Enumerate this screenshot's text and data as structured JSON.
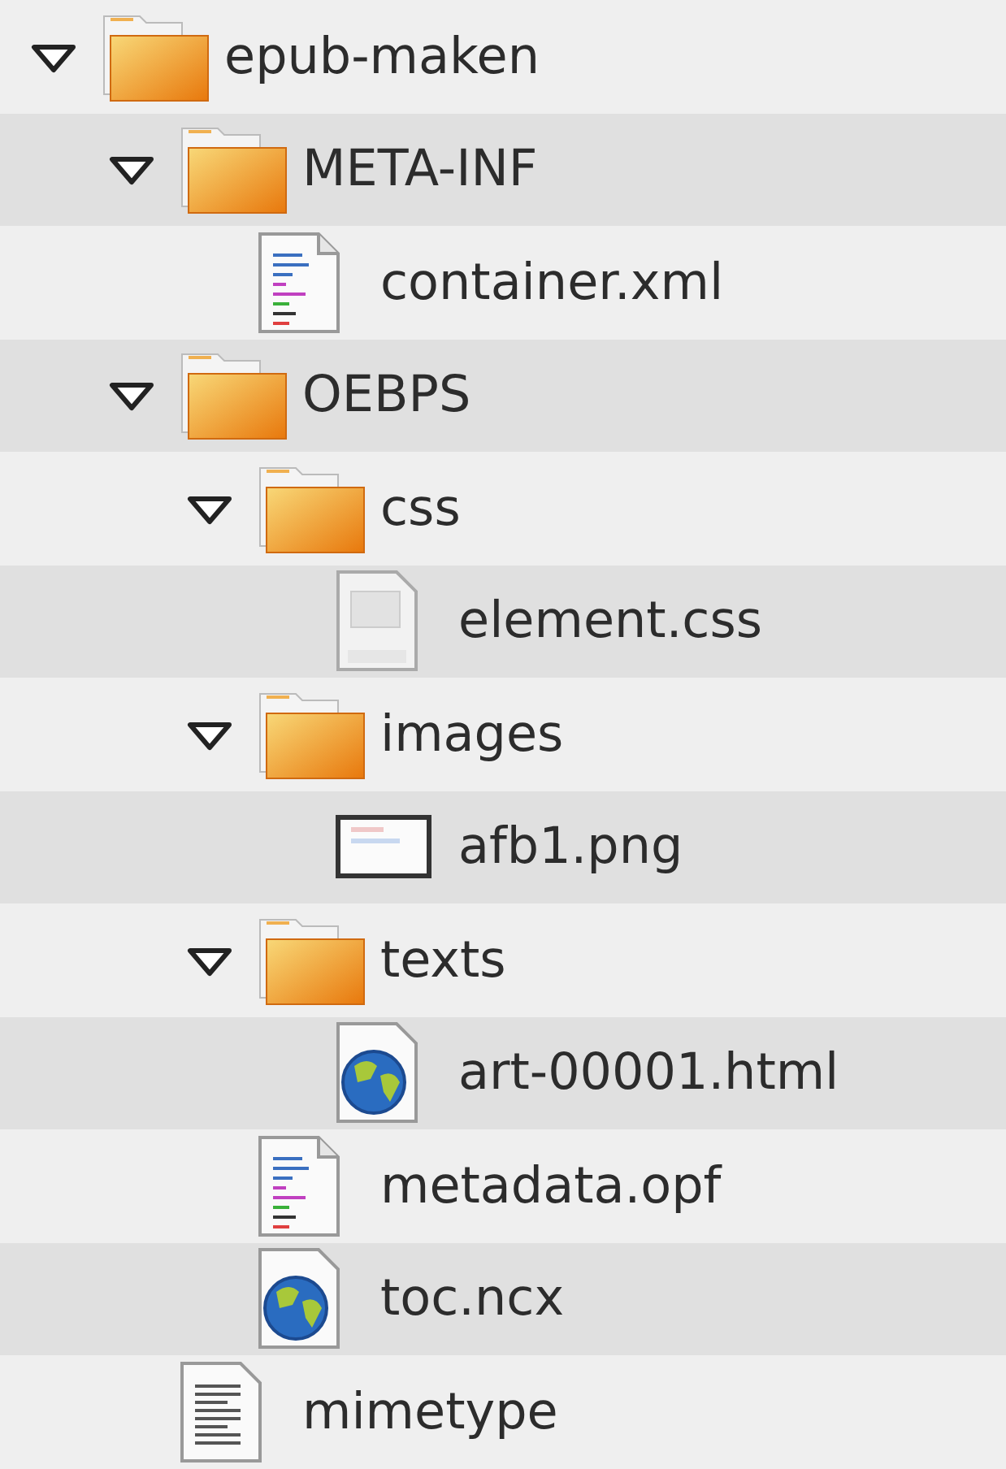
{
  "items": [
    {
      "kind": "folder",
      "name": "epub-maken",
      "expanded": true,
      "children": [
        {
          "kind": "folder",
          "name": "META-INF",
          "expanded": true,
          "children": [
            {
              "kind": "document",
              "name": "container.xml"
            }
          ]
        },
        {
          "kind": "folder",
          "name": "OEBPS",
          "expanded": true,
          "children": [
            {
              "kind": "folder",
              "name": "css",
              "expanded": true,
              "children": [
                {
                  "kind": "stylesheet",
                  "name": "element.css"
                }
              ]
            },
            {
              "kind": "folder",
              "name": "images",
              "expanded": true,
              "children": [
                {
                  "kind": "image",
                  "name": "afb1.png"
                }
              ]
            },
            {
              "kind": "folder",
              "name": "texts",
              "expanded": true,
              "children": [
                {
                  "kind": "web-page",
                  "name": "art-00001.html"
                }
              ]
            },
            {
              "kind": "document",
              "name": "metadata.opf"
            },
            {
              "kind": "web-page",
              "name": "toc.ncx"
            }
          ]
        },
        {
          "kind": "text",
          "name": "mimetype"
        }
      ]
    }
  ]
}
